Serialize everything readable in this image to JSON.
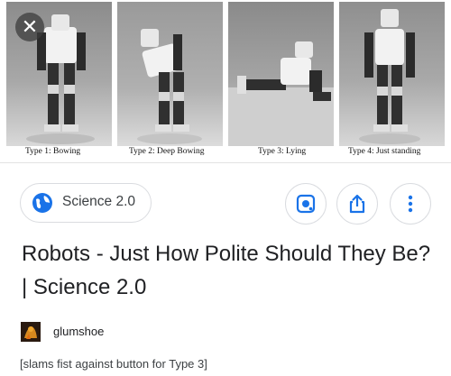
{
  "image_strip": {
    "captions": [
      "Type 1: Bowing",
      "Type 2: Deep Bowing",
      "Type 3: Lying",
      "Type 4: Just standing"
    ]
  },
  "close_icon": "close-icon",
  "source": {
    "name": "Science 2.0",
    "icon": "globe-icon"
  },
  "actions": {
    "lens_icon": "lens-icon",
    "share_icon": "share-icon",
    "more_icon": "more-vert-icon",
    "accent": "#1a73e8"
  },
  "title": "Robots - Just How Polite Should They Be? | Science 2.0",
  "post": {
    "username": "glumshoe",
    "comment": "[slams fist against button for Type 3]"
  }
}
